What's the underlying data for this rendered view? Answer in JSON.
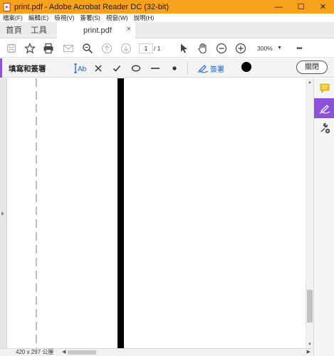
{
  "window": {
    "title": "print.pdf - Adobe Acrobat Reader DC (32-bit)",
    "minimize_glyph": "—",
    "maximize_glyph": "☐",
    "close_glyph": "✕"
  },
  "menu": {
    "items": [
      "檔案(F)",
      "編輯(E)",
      "檢視(V)",
      "簽署(S)",
      "視窗(W)",
      "說明(H)"
    ]
  },
  "tabs": {
    "home": "首頁",
    "tools": "工具",
    "document": "print.pdf",
    "document_close": "×"
  },
  "toolbar": {
    "page_current": "1",
    "page_total": "/ 1",
    "zoom": "300%",
    "more": "•••"
  },
  "sign_toolbar": {
    "title": "填寫和簽署",
    "text_tool": "Ab",
    "sign_label": "簽署",
    "close_label": "關閉",
    "selected_color": "#000000"
  },
  "status": {
    "page_size": "420 x 297 公厘"
  },
  "colors": {
    "titlebar": "#f7a21b",
    "accent_purple": "#8a52d6",
    "link_blue": "#1568d1"
  },
  "icons": {
    "toolbar": [
      "save-icon",
      "bookmark-star-icon",
      "print-icon",
      "email-icon",
      "search-icon",
      "page-up-icon",
      "page-down-icon",
      "select-arrow-icon",
      "hand-icon",
      "zoom-out-icon",
      "zoom-in-icon"
    ],
    "sign": [
      "text-cursor-icon",
      "cross-icon",
      "check-icon",
      "ellipse-icon",
      "line-icon",
      "dot-icon",
      "sign-pen-icon"
    ],
    "right_pane": [
      "comment-icon",
      "fill-sign-icon",
      "more-tools-icon"
    ]
  }
}
